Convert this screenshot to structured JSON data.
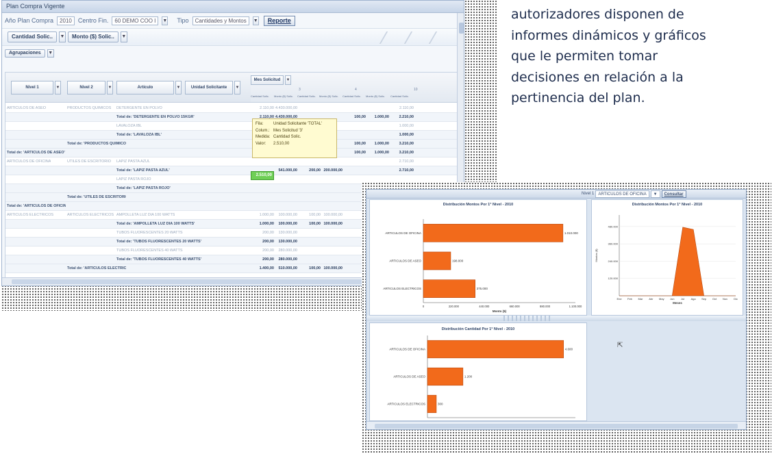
{
  "caption": {
    "lines": [
      "autorizadores disponen de",
      "informes dinámicos y gráficos",
      "que le permiten tomar",
      "decisiones en relación a la",
      "pertinencia del plan."
    ]
  },
  "report_window": {
    "title": "Plan Compra Vigente",
    "filters": {
      "year_label": "Año Plan Compra",
      "year_value": "2010",
      "center_label": "Centro Fin.",
      "center_value": "60 DEMO COO I",
      "type_label": "Tipo",
      "type_value": "Cantidades y Montos",
      "report_button": "Reporte"
    },
    "toolbar": {
      "measure_1": "Cantidad Solic..",
      "measure_2": "Monto ($) Solic..",
      "aggregation_label": "Agrupaciones"
    },
    "row_headers": [
      "Nivel 1",
      "Nivel 2",
      "Artículo",
      "Unidad Solicitante"
    ],
    "column_field": "Mes Solicitud",
    "column_numbers": [
      "3",
      "4",
      "10"
    ],
    "column_sublabels": [
      "Cantidad Solic.",
      "Monto ($) Solic.",
      "Cantidad Solic.",
      "Monto ($) Solic.",
      "Cantidad Solic.",
      "Monto ($) Solic.",
      "Cantidad Solic."
    ],
    "rows": [
      {
        "c1": "ARTICULOS DE ASEO",
        "c2": "PRODUCTOS QUIMICOS",
        "c3": "DETERGENTE EN POLVO",
        "v": [
          "2.110,00",
          "4.430.000,00",
          "",
          "",
          "",
          "",
          "2.110,00"
        ],
        "faint": true
      },
      {
        "c1": "",
        "c2": "",
        "c3": "Total de: 'DETERGENTE EN POLVO 15KGR'",
        "v": [
          "2.110,00",
          "4.430.000,00",
          "",
          "",
          "100,00",
          "1.000,00",
          "2.210,00"
        ],
        "total": true
      },
      {
        "c1": "",
        "c2": "",
        "c3": "LAVALOZA IBL",
        "v": [
          "1.000,00",
          "300.000,00",
          "",
          "",
          "",
          "",
          "1.000,00"
        ],
        "faint": true
      },
      {
        "c1": "",
        "c2": "",
        "c3": "Total de: 'LAVALOZA IBL'",
        "v": [
          "1.000,00",
          "300.000,00",
          "",
          "",
          "",
          "",
          "1.000,00"
        ],
        "total": true
      },
      {
        "c1": "",
        "c2": "Total de: 'PRODUCTOS QUIMICOS'",
        "c3": "",
        "v": [
          "3.110,00",
          "4.730.000,00",
          "",
          "",
          "100,00",
          "1.000,00",
          "3.210,00"
        ],
        "total": true
      },
      {
        "c1": "Total de: 'ARTICULOS DE ASEO'",
        "c2": "",
        "c3": "",
        "v": [
          "3.110,00",
          "4.730.000,00",
          "",
          "",
          "100,00",
          "1.000,00",
          "3.210,00"
        ],
        "total": true
      },
      {
        "c1": "ARTICULOS DE OFICINA",
        "c2": "UTILES DE ESCRITORIO",
        "c3": "LAPIZ PASTA AZUL",
        "v": [
          "",
          "",
          "",
          "",
          "",
          "",
          "2.710,00"
        ],
        "faint": true
      },
      {
        "c1": "",
        "c2": "",
        "c3": "Total de: 'LAPIZ PASTA AZUL'",
        "v": [
          "",
          "541.000,00",
          "200,00",
          "200.000,00",
          "",
          "",
          "2.710,00"
        ],
        "total": true
      },
      {
        "c1": "",
        "c2": "",
        "c3": "LAPIZ PASTA ROJO",
        "v": [
          "",
          "",
          "",
          "",
          "",
          "",
          ""
        ],
        "faint": true
      },
      {
        "c1": "",
        "c2": "",
        "c3": "Total de: 'LAPIZ PASTA ROJO'",
        "v": [
          "",
          "",
          "",
          "",
          "",
          "",
          ""
        ],
        "total": true
      },
      {
        "c1": "",
        "c2": "Total de: 'UTILES DE ESCRITORIO'",
        "c3": "",
        "v": [
          "",
          "",
          "",
          "",
          "",
          "",
          ""
        ],
        "total": true
      },
      {
        "c1": "Total de: 'ARTICULOS DE OFICINA'",
        "c2": "",
        "c3": "",
        "v": [
          "",
          "",
          "",
          "",
          "",
          "",
          ""
        ],
        "total": true
      },
      {
        "c1": "ARTICULOS ELECTRICOS",
        "c2": "ARTICULOS ELECTRICOS",
        "c3": "AMPOLLETA LUZ DIA 100 WATTS",
        "v": [
          "1.000,00",
          "100.000,00",
          "100,00",
          "100.000,00",
          "",
          "",
          ""
        ],
        "faint": true
      },
      {
        "c1": "",
        "c2": "",
        "c3": "Total de: 'AMPOLLETA LUZ DIA 100 WATTS'",
        "v": [
          "1.000,00",
          "100.000,00",
          "100,00",
          "100.000,00",
          "",
          "",
          ""
        ],
        "total": true
      },
      {
        "c1": "",
        "c2": "",
        "c3": "TUBOS FLUORESCENTES 20 WATTS",
        "v": [
          "200,00",
          "130.000,00",
          "",
          "",
          "",
          "",
          ""
        ],
        "faint": true
      },
      {
        "c1": "",
        "c2": "",
        "c3": "Total de: 'TUBOS FLUORESCENTES 20 WATTS'",
        "v": [
          "200,00",
          "130.000,00",
          "",
          "",
          "",
          "",
          ""
        ],
        "total": true
      },
      {
        "c1": "",
        "c2": "",
        "c3": "TUBOS FLUORESCENTES 40 WATTS",
        "v": [
          "200,00",
          "280.000,00",
          "",
          "",
          "",
          "",
          ""
        ],
        "faint": true
      },
      {
        "c1": "",
        "c2": "",
        "c3": "Total de: 'TUBOS FLUORESCENTES 40 WATTS'",
        "v": [
          "200,00",
          "280.000,00",
          "",
          "",
          "",
          "",
          ""
        ],
        "total": true
      },
      {
        "c1": "",
        "c2": "Total de: 'ARTICULOS ELECTRICOS'",
        "c3": "",
        "v": [
          "1.400,00",
          "510.000,00",
          "100,00",
          "100.000,00",
          "",
          "",
          ""
        ],
        "total": true
      }
    ],
    "highlighted_cell": "2.510,00",
    "tooltip": {
      "row_label": "Fila:",
      "row_value": "Unidad Solicitante 'TOTAL'",
      "col_label": "Colum.:",
      "col_value": "Mes Solicitud '3'",
      "measure_label": "Medida:",
      "measure_value": "Cantidad Solic.",
      "value_label": "Valor:",
      "value_value": "2.510,00"
    }
  },
  "charts_window": {
    "filter_label": "Nivel 1",
    "filter_value": "ARTICULOS DE OFICINA",
    "filter_button": "Consultar",
    "accent_color": "#f26a1b"
  },
  "chart_data": [
    {
      "type": "bar",
      "orientation": "horizontal",
      "title": "Distribución Montos Por 1° Nivel - 2010",
      "categories": [
        "ARTICULOS DE OFICINA",
        "ARTICULOS DE ASEO",
        "ARTICULOS ELECTRICOS"
      ],
      "values": [
        1010000,
        198000,
        375000
      ],
      "data_labels": [
        "1.010.000",
        "198.000",
        "375.000"
      ],
      "xlabel": "Monto ($)",
      "x_ticks": [
        "0",
        "220.000",
        "440.000",
        "660.000",
        "880.000",
        "1.100.000"
      ],
      "xlim": [
        0,
        1100000
      ]
    },
    {
      "type": "area",
      "title": "Distribución Montos Por 1° Nivel - 2010",
      "x": [
        "Ene",
        "Feb",
        "Mar",
        "Abr",
        "May",
        "Jun",
        "Jul",
        "Ago",
        "Sep",
        "Oct",
        "Nov",
        "Dic"
      ],
      "values": [
        0,
        0,
        0,
        0,
        0,
        0,
        475000,
        460000,
        0,
        0,
        0,
        0
      ],
      "xlabel": "Meses",
      "ylabel": "Montos ($)",
      "y_ticks": [
        "120.000",
        "240.000",
        "360.000",
        "480.000"
      ],
      "ylim": [
        0,
        560000
      ]
    },
    {
      "type": "bar",
      "orientation": "horizontal",
      "title": "Distribución Cantidad Por 1° Nivel - 2010",
      "categories": [
        "ARTICULOS DE OFICINA",
        "ARTICULOS DE ASEO",
        "ARTICULOS ELECTRICOS"
      ],
      "values": [
        4600,
        1200,
        300
      ],
      "data_labels": [
        "4.600",
        "1.200",
        "300"
      ],
      "xlim": [
        0,
        5000
      ]
    }
  ]
}
